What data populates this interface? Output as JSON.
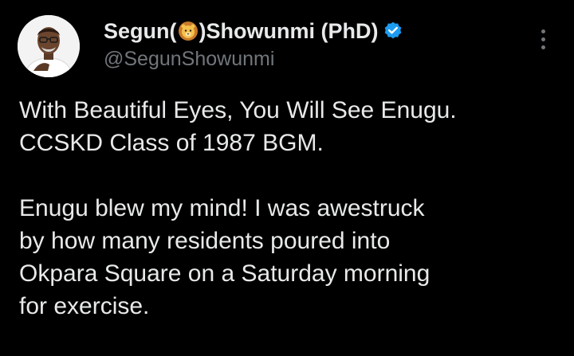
{
  "author": {
    "name_prefix": "Segun(",
    "name_emoji": "lion-face-emoji",
    "name_suffix": ")Showunmi (PhD)",
    "handle": "@SegunShowunmi",
    "verified_color": "#1d9bf0"
  },
  "icons": {
    "avatar": "profile-photo",
    "verified": "verified-badge-icon",
    "more": "more-options-icon"
  },
  "tweet": {
    "paragraph1": [
      "With Beautiful Eyes, You Will See Enugu.",
      "CCSKD Class of 1987 BGM."
    ],
    "paragraph2": [
      "Enugu blew my mind! I was awestruck",
      "by how many residents poured into",
      "Okpara Square on a Saturday morning",
      "for exercise."
    ]
  },
  "colors": {
    "background": "#000000",
    "text": "#e7e9ea",
    "secondary": "#71767b"
  }
}
